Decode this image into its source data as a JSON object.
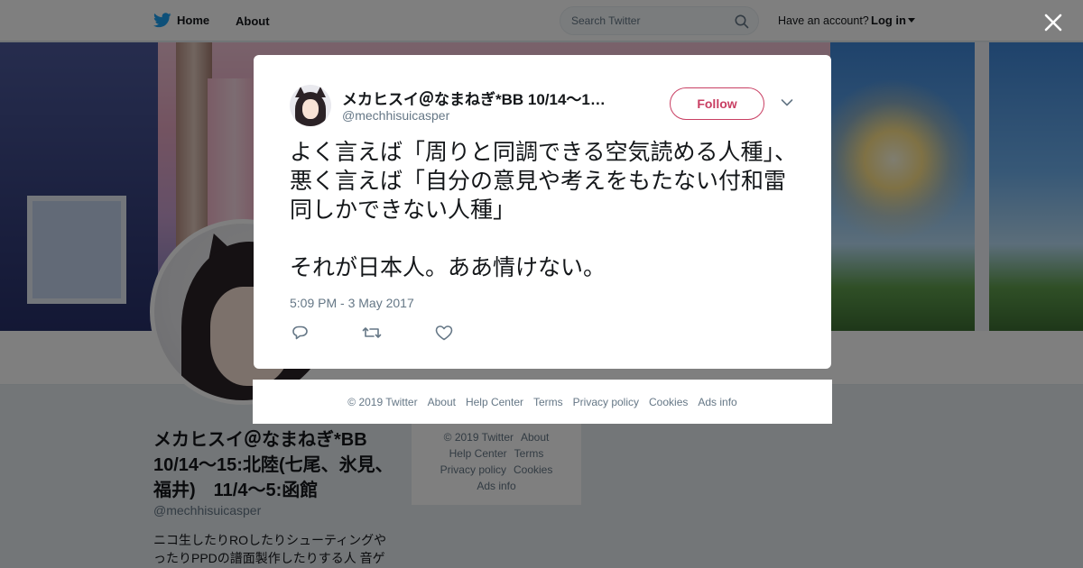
{
  "topbar": {
    "home_label": "Home",
    "about_label": "About",
    "search_placeholder": "Search Twitter",
    "have_account": "Have an account?",
    "login_label": "Log in"
  },
  "profile": {
    "name": "メカヒスイ＠なまねぎ*BB 10/14～15:北陸(七尾、氷見、福井)　11/4～5:函館",
    "handle": "@mechhisuicasper",
    "bio": "ニコ生したりROしたりシューティングやったりPPDの譜面製作したりする人 音ゲ"
  },
  "side_footer": {
    "items": [
      "© 2019 Twitter",
      "About",
      "Help Center",
      "Terms",
      "Privacy policy",
      "Cookies",
      "Ads info"
    ]
  },
  "tweet": {
    "display_name": "メカヒスイ＠なまねぎ*BB 10/14～1…",
    "handle": "@mechhisuicasper",
    "follow_label": "Follow",
    "text": "よく言えば「周りと同調できる空気読める人種」、悪く言えば「自分の意見や考えをもたない付和雷同しかできない人種」\n\nそれが日本人。ああ情けない。",
    "timestamp": "5:09 PM - 3 May 2017"
  },
  "modal_footer": {
    "items": [
      "© 2019 Twitter",
      "About",
      "Help Center",
      "Terms",
      "Privacy policy",
      "Cookies",
      "Ads info"
    ]
  },
  "icons": {
    "brand": "twitter-bird-icon",
    "search": "search-icon",
    "close": "close-icon",
    "reply": "reply-icon",
    "retweet": "retweet-icon",
    "like": "heart-icon",
    "more": "chevron-down-icon"
  },
  "colors": {
    "twitter_blue": "#1da1f2",
    "follow_accent": "#c93f63",
    "text_primary": "#14171a",
    "text_secondary": "#657786"
  }
}
